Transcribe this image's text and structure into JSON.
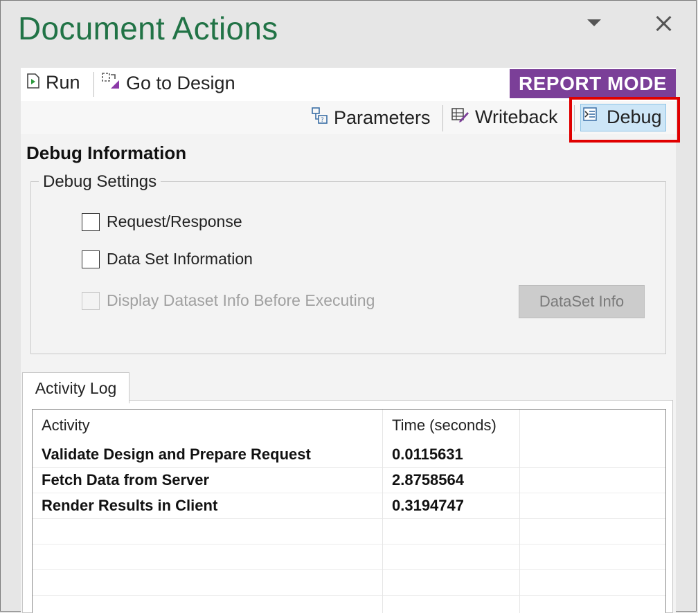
{
  "pane": {
    "title": "Document Actions"
  },
  "toolbar": {
    "run_label": "Run",
    "go_to_design_label": "Go to Design",
    "mode_badge": "REPORT MODE",
    "parameters_label": "Parameters",
    "writeback_label": "Writeback",
    "debug_label": "Debug"
  },
  "debug": {
    "section_title": "Debug Information",
    "settings_legend": "Debug Settings",
    "request_response_label": "Request/Response",
    "dataset_information_label": "Data Set Information",
    "display_dataset_label": "Display Dataset Info Before Executing",
    "dataset_info_button": "DataSet Info"
  },
  "activity_log": {
    "tab_label": "Activity Log",
    "columns": [
      "Activity",
      "Time (seconds)"
    ],
    "rows": [
      {
        "activity": "Validate Design and Prepare Request",
        "time": "0.0115631"
      },
      {
        "activity": "Fetch Data from Server",
        "time": "2.8758564"
      },
      {
        "activity": "Render Results in Client",
        "time": "0.3194747"
      }
    ]
  },
  "colors": {
    "title_green": "#217346",
    "report_mode_purple": "#7b3f98",
    "debug_active_bg": "#cde6f7",
    "highlight_red": "#e00000"
  }
}
